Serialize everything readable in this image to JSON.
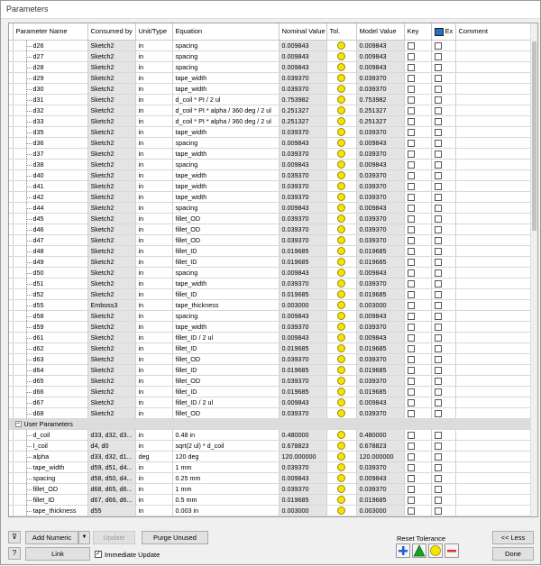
{
  "window": {
    "title": "Parameters"
  },
  "columns": [
    "Parameter Name",
    "Consumed by",
    "Unit/Type",
    "Equation",
    "Nominal Value",
    "Tol.",
    "Model Value",
    "Key",
    "Ex",
    "Comment"
  ],
  "model_rows": [
    [
      "d26",
      "Sketch2",
      "in",
      "spacing",
      "0.009843",
      "0.009843"
    ],
    [
      "d27",
      "Sketch2",
      "in",
      "spacing",
      "0.009843",
      "0.009843"
    ],
    [
      "d28",
      "Sketch2",
      "in",
      "spacing",
      "0.009843",
      "0.009843"
    ],
    [
      "d29",
      "Sketch2",
      "in",
      "tape_width",
      "0.039370",
      "0.039370"
    ],
    [
      "d30",
      "Sketch2",
      "in",
      "tape_width",
      "0.039370",
      "0.039370"
    ],
    [
      "d31",
      "Sketch2",
      "in",
      "d_coil * PI / 2 ul",
      "0.753982",
      "0.753982"
    ],
    [
      "d32",
      "Sketch2",
      "in",
      "d_coil * PI * alpha / 360 deg / 2 ul",
      "0.251327",
      "0.251327"
    ],
    [
      "d33",
      "Sketch2",
      "in",
      "d_coil * PI * alpha / 360 deg / 2 ul",
      "0.251327",
      "0.251327"
    ],
    [
      "d35",
      "Sketch2",
      "in",
      "tape_width",
      "0.039370",
      "0.039370"
    ],
    [
      "d36",
      "Sketch2",
      "in",
      "spacing",
      "0.009843",
      "0.009843"
    ],
    [
      "d37",
      "Sketch2",
      "in",
      "tape_width",
      "0.039370",
      "0.039370"
    ],
    [
      "d38",
      "Sketch2",
      "in",
      "spacing",
      "0.009843",
      "0.009843"
    ],
    [
      "d40",
      "Sketch2",
      "in",
      "tape_width",
      "0.039370",
      "0.039370"
    ],
    [
      "d41",
      "Sketch2",
      "in",
      "tape_width",
      "0.039370",
      "0.039370"
    ],
    [
      "d42",
      "Sketch2",
      "in",
      "tape_width",
      "0.039370",
      "0.039370"
    ],
    [
      "d44",
      "Sketch2",
      "in",
      "spacing",
      "0.009843",
      "0.009843"
    ],
    [
      "d45",
      "Sketch2",
      "in",
      "fillet_OD",
      "0.039370",
      "0.039370"
    ],
    [
      "d46",
      "Sketch2",
      "in",
      "fillet_OD",
      "0.039370",
      "0.039370"
    ],
    [
      "d47",
      "Sketch2",
      "in",
      "fillet_OD",
      "0.039370",
      "0.039370"
    ],
    [
      "d48",
      "Sketch2",
      "in",
      "fillet_ID",
      "0.019685",
      "0.019685"
    ],
    [
      "d49",
      "Sketch2",
      "in",
      "fillet_ID",
      "0.019685",
      "0.019685"
    ],
    [
      "d50",
      "Sketch2",
      "in",
      "spacing",
      "0.009843",
      "0.009843"
    ],
    [
      "d51",
      "Sketch2",
      "in",
      "tape_width",
      "0.039370",
      "0.039370"
    ],
    [
      "d52",
      "Sketch2",
      "in",
      "fillet_ID",
      "0.019685",
      "0.019685"
    ],
    [
      "d55",
      "Emboss3",
      "in",
      "tape_thickness",
      "0.003000",
      "0.003000"
    ],
    [
      "d58",
      "Sketch2",
      "in",
      "spacing",
      "0.009843",
      "0.009843"
    ],
    [
      "d59",
      "Sketch2",
      "in",
      "tape_width",
      "0.039370",
      "0.039370"
    ],
    [
      "d61",
      "Sketch2",
      "in",
      "fillet_ID / 2 ul",
      "0.009843",
      "0.009843"
    ],
    [
      "d62",
      "Sketch2",
      "in",
      "fillet_ID",
      "0.019685",
      "0.019685"
    ],
    [
      "d63",
      "Sketch2",
      "in",
      "fillet_OD",
      "0.039370",
      "0.039370"
    ],
    [
      "d64",
      "Sketch2",
      "in",
      "fillet_ID",
      "0.019685",
      "0.019685"
    ],
    [
      "d65",
      "Sketch2",
      "in",
      "fillet_OD",
      "0.039370",
      "0.039370"
    ],
    [
      "d66",
      "Sketch2",
      "in",
      "fillet_ID",
      "0.019685",
      "0.019685"
    ],
    [
      "d67",
      "Sketch2",
      "in",
      "fillet_ID / 2 ul",
      "0.009843",
      "0.009843"
    ],
    [
      "d68",
      "Sketch2",
      "in",
      "fillet_OD",
      "0.039370",
      "0.039370"
    ]
  ],
  "user_group": {
    "label": "User Parameters",
    "expander": "−"
  },
  "user_rows": [
    [
      "d_coil",
      "d33, d32, d3...",
      "in",
      "0.48 in",
      "0.480000",
      "0.480000"
    ],
    [
      "l_coil",
      "d4, d0",
      "in",
      "sqrt(2 ul) * d_coil",
      "0.678823",
      "0.678823"
    ],
    [
      "alpha",
      "d33, d32, d1...",
      "deg",
      "120 deg",
      "120.000000",
      "120.000000"
    ],
    [
      "tape_width",
      "d59, d51, d4...",
      "in",
      "1 mm",
      "0.039370",
      "0.039370"
    ],
    [
      "spacing",
      "d58, d50, d4...",
      "in",
      "0.25 mm",
      "0.009843",
      "0.009843"
    ],
    [
      "fillet_OD",
      "d68, d65, d6...",
      "in",
      "1 mm",
      "0.039370",
      "0.039370"
    ],
    [
      "fillet_ID",
      "d67, d66, d6...",
      "in",
      "0.5 mm",
      "0.019685",
      "0.019685"
    ],
    [
      "tape_thickness",
      "d55",
      "in",
      "0.003 in",
      "0.003000",
      "0.003000"
    ]
  ],
  "bottom": {
    "add_numeric": "Add Numeric",
    "dropdown": "▼",
    "update": "Update",
    "purge_unused": "Purge Unused",
    "link": "Link",
    "immediate_update": "Immediate Update",
    "reset_tolerance": "Reset Tolerance",
    "less": "<< Less",
    "done": "Done",
    "filter_glyph": "⊽",
    "help_glyph": "?",
    "immediate_checked": "✓"
  },
  "colors": {
    "tol": "#f5e400",
    "blue": "#1e5fd8",
    "green": "#19a02a",
    "red": "#e03030"
  },
  "icons": [
    "filter-icon",
    "help-icon",
    "export-icon",
    "tolerance-upper-icon",
    "tolerance-median-icon",
    "tolerance-nominal-icon",
    "tolerance-lower-icon"
  ]
}
